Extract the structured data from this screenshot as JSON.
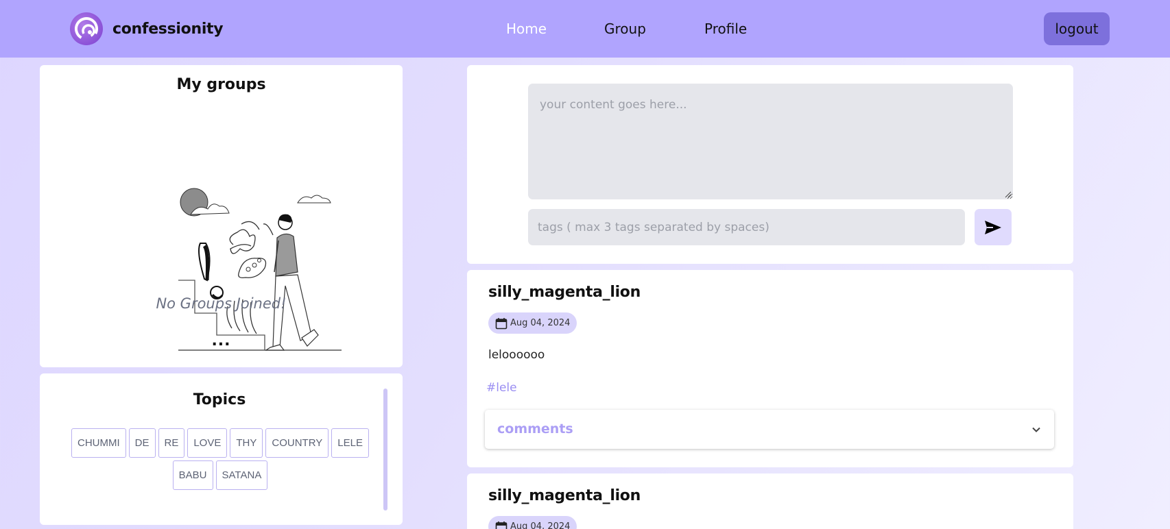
{
  "header": {
    "brand_name": "confessionity",
    "nav": [
      {
        "label": "Home",
        "active": true
      },
      {
        "label": "Group",
        "active": false
      },
      {
        "label": "Profile",
        "active": false
      }
    ],
    "logout_label": "logout"
  },
  "groups": {
    "title": "My groups",
    "empty_text": "No Groups Joined!",
    "more": "..."
  },
  "topics": {
    "title": "Topics",
    "tags": [
      "CHUMMI",
      "DE",
      "RE",
      "LOVE",
      "THY",
      "COUNTRY",
      "LELE",
      "BABU",
      "SATANA"
    ]
  },
  "composer": {
    "content_placeholder": "your content goes here...",
    "tags_placeholder": "tags ( max 3 tags separated by spaces)",
    "send_icon": "send-icon"
  },
  "posts": [
    {
      "author": "silly_magenta_lion",
      "date": "Aug 04, 2024",
      "body": "leloooooo",
      "tag": "#lele",
      "comments_label": "comments"
    },
    {
      "author": "silly_magenta_lion",
      "date": "Aug 04, 2024"
    }
  ],
  "colors": {
    "header_bg": "#b0a4fe",
    "logout_bg": "#7d70dc",
    "accent": "#ab9ef5",
    "page_bg": "#e3defe"
  }
}
